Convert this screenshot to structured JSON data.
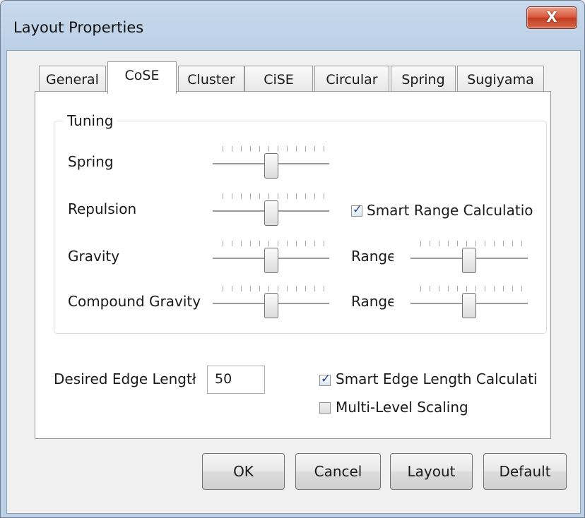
{
  "window": {
    "title": "Layout Properties",
    "close_glyph": "X"
  },
  "tabs": [
    "General",
    "CoSE",
    "Cluster",
    "CiSE",
    "Circular",
    "Spring",
    "Sugiyama"
  ],
  "active_tab": "CoSE",
  "tuning": {
    "group_title": "Tuning",
    "spring_label": "Spring",
    "repulsion_label": "Repulsion",
    "gravity_label": "Gravity",
    "compound_gravity_label": "Compound Gravity",
    "range_label": "Range",
    "smart_range_label": "Smart Range Calculatio",
    "smart_range_checked": true,
    "slider_levels": {
      "spring": 0.5,
      "repulsion": 0.5,
      "gravity": 0.5,
      "compound_gravity": 0.5,
      "gravity_range": 0.5,
      "compound_gravity_range": 0.5
    }
  },
  "edge": {
    "desired_edge_label": "Desired Edge Lengtł",
    "desired_edge_value": "50",
    "smart_edge_label": "Smart Edge Length Calculati",
    "smart_edge_checked": true,
    "multi_level_label": "Multi-Level Scaling",
    "multi_level_checked": false
  },
  "buttons": {
    "ok": "OK",
    "cancel": "Cancel",
    "layout": "Layout",
    "default": "Default"
  },
  "check_glyph": "✓",
  "colors": {
    "close_button": "#c8452a",
    "title_bar": "#c8d9ec",
    "check_mark": "#25498f"
  }
}
